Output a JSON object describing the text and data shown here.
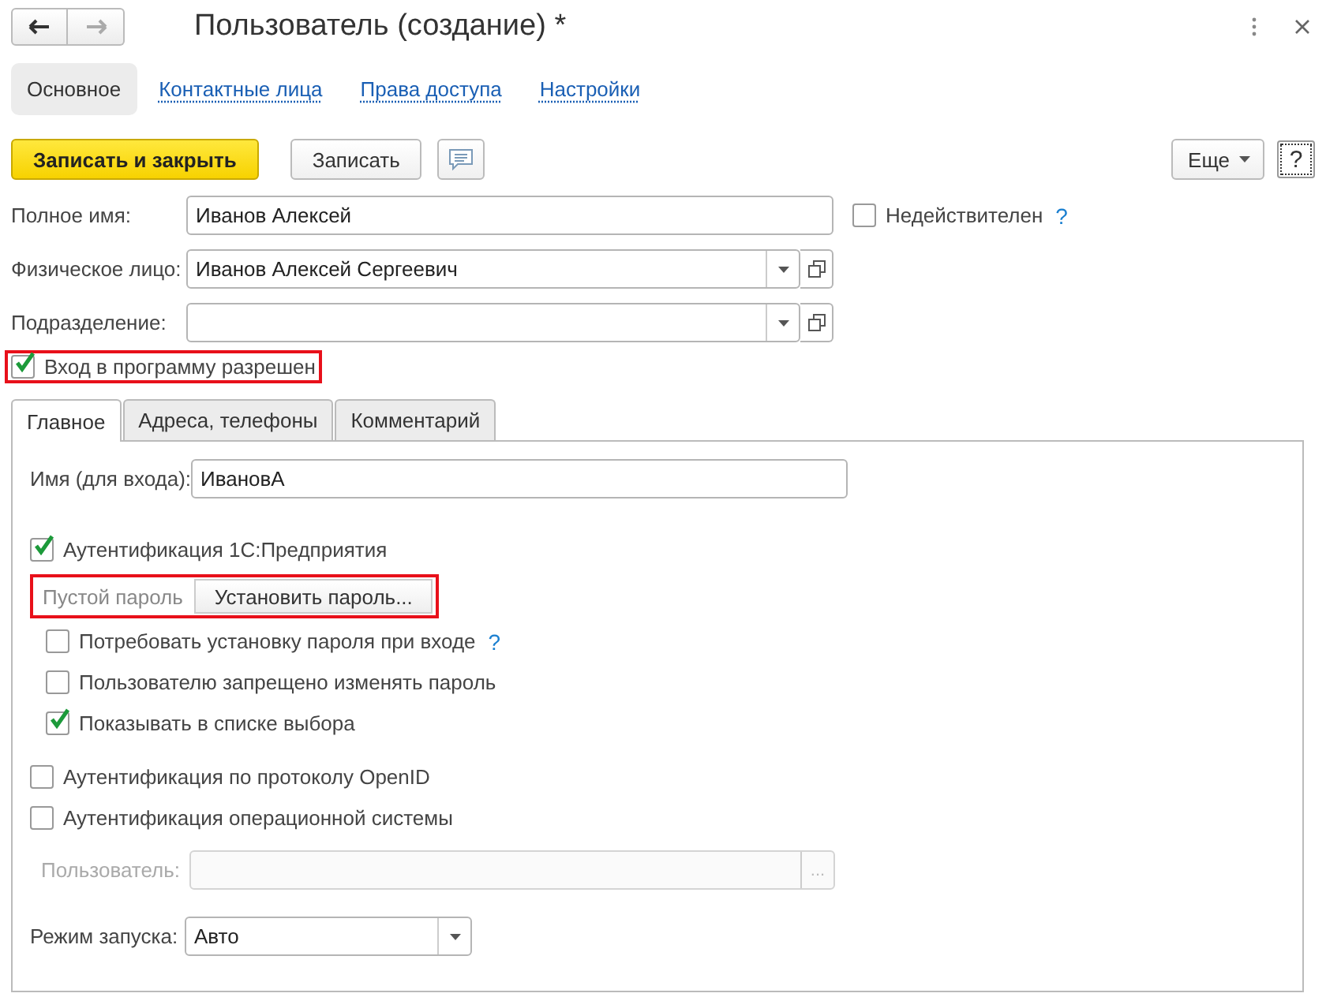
{
  "window": {
    "title": "Пользователь (создание) *",
    "nav": [
      {
        "kind": "back",
        "disabled": false
      },
      {
        "kind": "forward",
        "disabled": true
      }
    ]
  },
  "sections": [
    {
      "label": "Основное",
      "selected": true
    },
    {
      "label": "Контактные лица",
      "selected": false
    },
    {
      "label": "Права доступа",
      "selected": false
    },
    {
      "label": "Настройки",
      "selected": false
    }
  ],
  "toolbar": {
    "buttons": [
      {
        "kind": "primary",
        "label": "Записать и закрыть"
      },
      {
        "kind": "normal",
        "label": "Записать"
      },
      {
        "kind": "comment"
      }
    ],
    "more": "Еще",
    "help": "?"
  },
  "fields": [
    {
      "kind": "text",
      "label": "Полное имя:",
      "value": "Иванов Алексей"
    },
    {
      "kind": "choice",
      "label": "Физическое лицо:",
      "value": "Иванов Алексей Сергеевич"
    },
    {
      "kind": "choice",
      "label": "Подразделение:"
    }
  ],
  "invalid": {
    "label": "Недействителен",
    "checked": false,
    "help": "?"
  },
  "login_allowed": {
    "label": "Вход в программу разрешен",
    "checked": true,
    "highlighted": true
  },
  "tabs": [
    {
      "label": "Главное",
      "selected": true
    },
    {
      "label": "Адреса, телефоны",
      "selected": false
    },
    {
      "label": "Комментарий",
      "selected": false
    }
  ],
  "login": {
    "label": "Имя (для входа):",
    "value": "ИвановА"
  },
  "auth_1c": {
    "label": "Аутентификация 1С:Предприятия",
    "checked": true
  },
  "password": {
    "status": "Пустой пароль",
    "button": "Установить пароль...",
    "highlighted": true
  },
  "password_options": [
    {
      "label": "Потребовать установку пароля при входе",
      "checked": false,
      "help": "?"
    },
    {
      "label": "Пользователю запрещено изменять пароль",
      "checked": false
    },
    {
      "label": "Показывать в списке выбора",
      "checked": true
    }
  ],
  "auth_other": [
    {
      "label": "Аутентификация по протоколу OpenID",
      "checked": false
    },
    {
      "label": "Аутентификация операционной системы",
      "checked": false
    }
  ],
  "os_user": {
    "label": "Пользователь:",
    "disabled": true,
    "button": "..."
  },
  "launch_mode": {
    "label": "Режим запуска:",
    "value": "Авто"
  }
}
